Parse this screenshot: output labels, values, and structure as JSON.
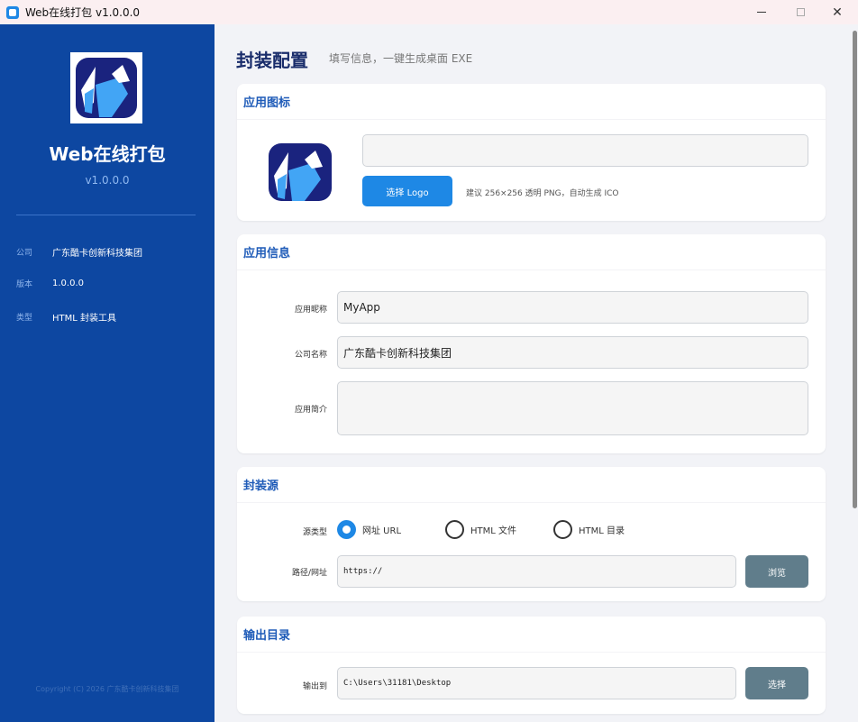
{
  "window": {
    "title": "Web在线打包 v1.0.0.0",
    "minimize_icon": "minimize-icon",
    "maximize_icon": "maximize-icon",
    "close_icon": "close-icon"
  },
  "sidebar": {
    "app_name": "Web在线打包",
    "version": "v1.0.0.0",
    "info": [
      {
        "label": "公司",
        "value": "广东酷卡创新科技集团"
      },
      {
        "label": "版本",
        "value": "1.0.0.0"
      },
      {
        "label": "类型",
        "value": "HTML 封装工具"
      }
    ],
    "copyright": "Copyright (C) 2026 广东酷卡创新科技集团",
    "colors": {
      "background": "#0d47a1",
      "accent": "#1e88e5"
    }
  },
  "main": {
    "title": "封装配置",
    "subtitle": "填写信息，一键生成桌面 EXE",
    "icon_section": {
      "title": "应用图标",
      "path_value": "",
      "select_button": "选择 Logo",
      "hint": "建议 256×256 透明 PNG，自动生成 ICO"
    },
    "info_section": {
      "title": "应用信息",
      "fields": [
        {
          "label": "应用昵称",
          "value": "MyApp"
        },
        {
          "label": "公司名称",
          "value": "广东酷卡创新科技集团"
        },
        {
          "label": "应用简介",
          "value": ""
        }
      ]
    },
    "source_section": {
      "title": "封装源",
      "type_label": "源类型",
      "options": [
        {
          "label": "网址 URL",
          "selected": true
        },
        {
          "label": "HTML 文件",
          "selected": false
        },
        {
          "label": "HTML 目录",
          "selected": false
        }
      ],
      "path_label": "路径/网址",
      "path_value": "https://",
      "browse_button": "浏览"
    },
    "output_section": {
      "title": "输出目录",
      "label": "输出到",
      "value": "C:\\Users\\31181\\Desktop",
      "select_button": "选择"
    }
  }
}
